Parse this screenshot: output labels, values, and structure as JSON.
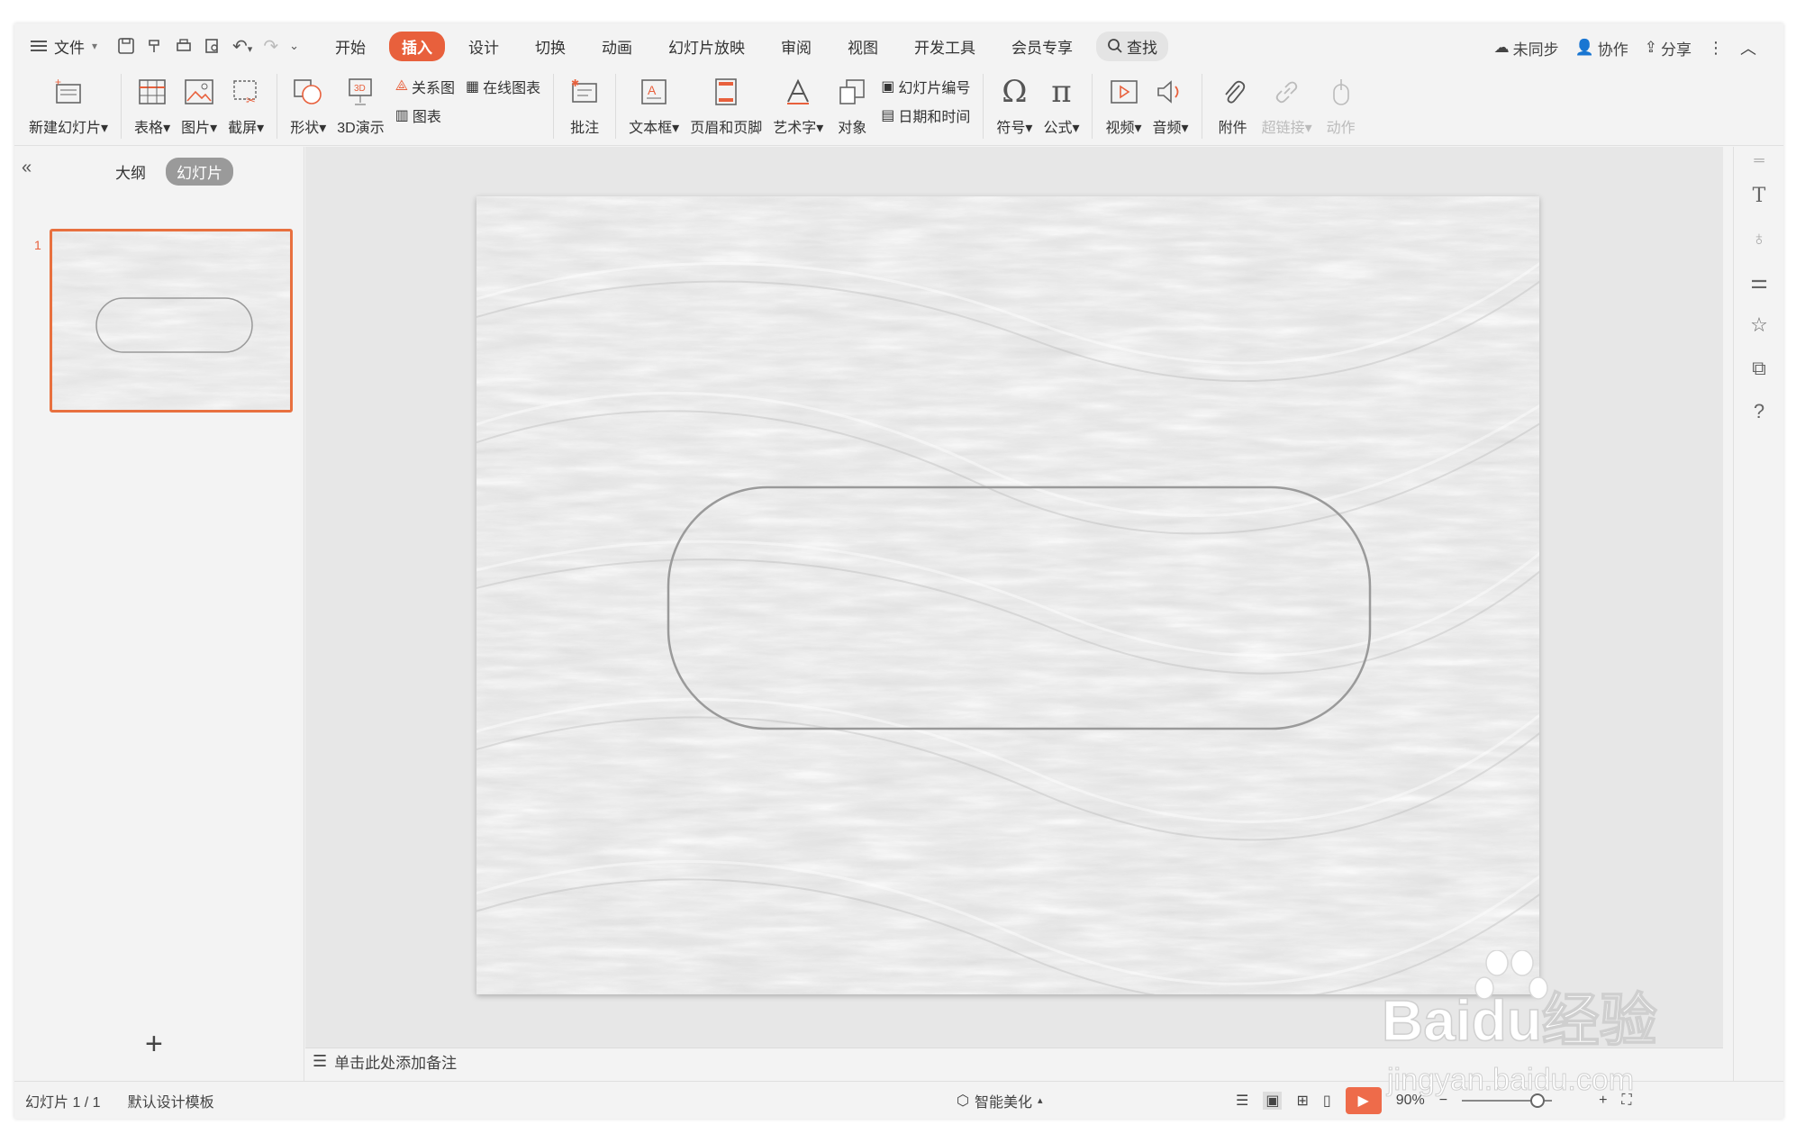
{
  "menubar": {
    "file_label": "文件",
    "tabs": [
      {
        "label": "开始"
      },
      {
        "label": "插入",
        "active": true
      },
      {
        "label": "设计"
      },
      {
        "label": "切换"
      },
      {
        "label": "动画"
      },
      {
        "label": "幻灯片放映"
      },
      {
        "label": "审阅"
      },
      {
        "label": "视图"
      },
      {
        "label": "开发工具"
      },
      {
        "label": "会员专享"
      }
    ],
    "search_label": "查找",
    "sync_label": "未同步",
    "collab_label": "协作",
    "share_label": "分享"
  },
  "ribbon": {
    "new_slide": "新建幻灯片",
    "table": "表格",
    "picture": "图片",
    "screenshot": "截屏",
    "shape": "形状",
    "three_d": "3D演示",
    "relation": "关系图",
    "online_chart": "在线图表",
    "chart": "图表",
    "comment": "批注",
    "textbox": "文本框",
    "header_footer": "页眉和页脚",
    "wordart": "艺术字",
    "object": "对象",
    "slide_number": "幻灯片编号",
    "date_time": "日期和时间",
    "symbol": "符号",
    "formula": "公式",
    "video": "视频",
    "audio": "音频",
    "attachment": "附件",
    "hyperlink": "超链接",
    "action": "动作"
  },
  "leftpanel": {
    "tab_outline": "大纲",
    "tab_slides": "幻灯片",
    "thumb_number": "1"
  },
  "notes": {
    "placeholder": "单击此处添加备注"
  },
  "statusbar": {
    "slide_info": "幻灯片 1 / 1",
    "template": "默认设计模板",
    "beautify": "智能美化",
    "zoom": "90%"
  },
  "watermark": {
    "brand": "Baidu经验",
    "url": "jingyan.baidu.com"
  },
  "colors": {
    "accent": "#e8603c",
    "thumb_border": "#e8703f",
    "slide_bg": "#e4e4e4"
  }
}
